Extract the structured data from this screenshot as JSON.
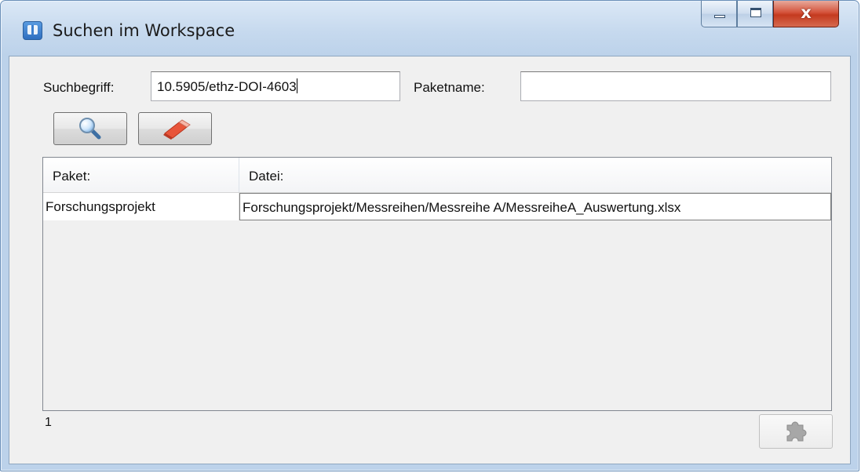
{
  "window": {
    "title": "Suchen im Workspace",
    "icon": "app-icon",
    "controls": {
      "minimize": "minimize-icon",
      "maximize": "maximize-icon",
      "close_glyph": "x"
    }
  },
  "form": {
    "search_label": "Suchbegriff:",
    "search_value": "10.5905/ethz-DOI-4603",
    "package_label": "Paketname:",
    "package_value": ""
  },
  "toolbar": {
    "search_button_icon": "magnifier-icon",
    "clear_button_icon": "eraser-icon"
  },
  "table": {
    "columns": [
      "Paket:",
      "Datei:"
    ],
    "rows": [
      [
        "Forschungsprojekt",
        "Forschungsprojekt/Messreihen/Messreihe A/MessreiheA_Auswertung.xlsx"
      ]
    ]
  },
  "footer": {
    "result_count": "1",
    "export_button_icon": "puzzle-icon",
    "export_button_enabled": false
  },
  "colors": {
    "title_gradient_top": "#dbe8f6",
    "close_button": "#c43a1f",
    "client_background": "#f0f0f0"
  }
}
